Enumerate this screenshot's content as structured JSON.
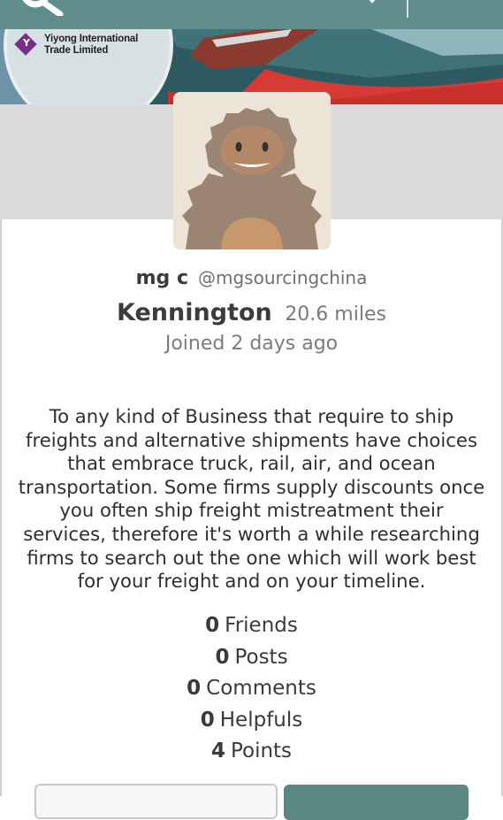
{
  "banner": {
    "company_name_line1": "Yiyong International",
    "company_name_line2": "Trade Limited",
    "badge_letter": "Y"
  },
  "profile": {
    "display_name": "mg c",
    "handle": "@mgsourcingchina",
    "location": "Kennington",
    "distance": "20.6 miles",
    "joined": "Joined 2 days ago"
  },
  "bio_lines": [
    "To any kind of Business that require to ship",
    "freights and alternative shipments have choices",
    "that embrace truck, rail, air, and ocean",
    "transportation. Some firms supply discounts once",
    "you often ship freight mistreatment their",
    "services, therefore it's worth a while researching",
    "firms to search out the one which will work best",
    "for your freight and on your timeline."
  ],
  "stats": [
    {
      "count": "0",
      "label": "Friends"
    },
    {
      "count": "0",
      "label": "Posts"
    },
    {
      "count": "0",
      "label": "Comments"
    },
    {
      "count": "0",
      "label": "Helpfuls"
    },
    {
      "count": "4",
      "label": "Points"
    }
  ],
  "colors": {
    "header": "#5f8d8a",
    "primary_button": "#5b8783",
    "brand_badge": "#7a2f86"
  },
  "icons": {
    "logo": "app-logo-icon",
    "header_right": "header-icon",
    "avatar": "default-avatar-icon"
  }
}
